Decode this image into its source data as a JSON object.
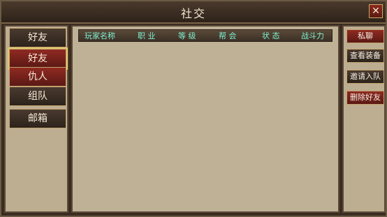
{
  "window": {
    "title": "社交",
    "close_icon": "✕"
  },
  "left_tabs": [
    {
      "label": "好友"
    },
    {
      "label": "好友"
    },
    {
      "label": "仇人"
    },
    {
      "label": "组队"
    },
    {
      "label": "邮箱"
    }
  ],
  "table": {
    "headers": [
      "玩家名称",
      "职 业",
      "等 级",
      "帮 会",
      "状 态",
      "战斗力"
    ]
  },
  "right_buttons": [
    {
      "label": "私聊"
    },
    {
      "label": "查看装备"
    },
    {
      "label": "邀请入队"
    },
    {
      "label": "删除好友"
    }
  ]
}
